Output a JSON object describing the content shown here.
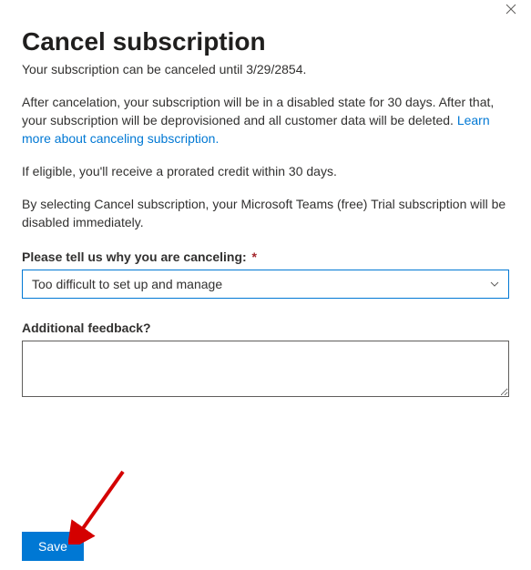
{
  "header": {
    "title": "Cancel subscription",
    "subtitle": "Your subscription can be canceled until 3/29/2854."
  },
  "body": {
    "para1a": "After cancelation, your subscription will be in a disabled state for 30 days. After that, your subscription will be deprovisioned and all customer data will be deleted. ",
    "learn_link": "Learn more about canceling subscription.",
    "para2": "If eligible, you'll receive a prorated credit within 30 days.",
    "para3": "By selecting Cancel subscription, your Microsoft Teams (free) Trial subscription will be disabled immediately."
  },
  "form": {
    "reason_label": "Please tell us why you are canceling:",
    "reason_required_mark": "*",
    "reason_selected": "Too difficult to set up and manage",
    "feedback_label": "Additional feedback?",
    "feedback_value": ""
  },
  "actions": {
    "save_label": "Save"
  }
}
